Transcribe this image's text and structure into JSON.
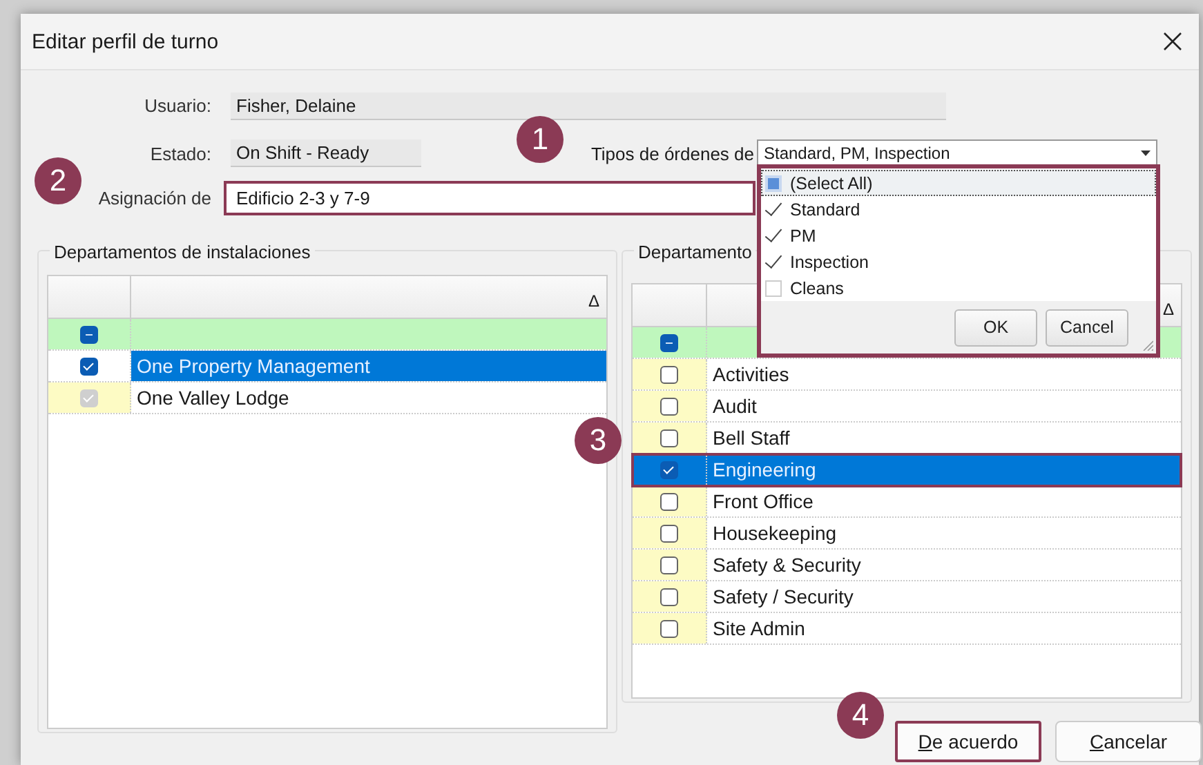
{
  "window": {
    "title": "Editar perfil de turno"
  },
  "form": {
    "user": {
      "label": "Usuario:",
      "value": "Fisher, Delaine"
    },
    "status": {
      "label": "Estado:",
      "value": "On Shift - Ready"
    },
    "order_types": {
      "label": "Tipos de órdenes de",
      "value": "Standard, PM, Inspection",
      "expanded": true
    },
    "assignment": {
      "label": "Asignación de",
      "value": "Edificio 2-3 y 7-9",
      "highlighted": true
    }
  },
  "order_types_popup": {
    "highlighted": true,
    "items": [
      {
        "label": "(Select All)",
        "indeterminate": true,
        "selected": true
      },
      {
        "label": "Standard",
        "checked": true,
        "indeterminate": false,
        "selected": false
      },
      {
        "label": "PM",
        "checked": true,
        "indeterminate": false,
        "selected": false
      },
      {
        "label": "Inspection",
        "checked": true,
        "indeterminate": false,
        "selected": false
      },
      {
        "label": "Cleans",
        "checked": false,
        "indeterminate": false,
        "selected": false
      }
    ],
    "buttons": [
      "OK",
      "Cancel"
    ]
  },
  "facility_departments": {
    "title": "Departamentos de instalaciones",
    "sort_mark": "Δ",
    "filter": {
      "indeterminate": true
    },
    "rows": [
      {
        "name": "One Property Management",
        "checked": true,
        "disabled": false,
        "selected": true,
        "highlighted": false
      },
      {
        "name": "One Valley Lodge",
        "checked": true,
        "disabled": true,
        "selected": false,
        "highlighted": false
      }
    ]
  },
  "departments": {
    "title": "Departamento",
    "sort_mark": "Δ",
    "filter": {
      "indeterminate": true
    },
    "rows": [
      {
        "name": "Activities",
        "checked": false,
        "disabled": false,
        "selected": false,
        "highlighted": false
      },
      {
        "name": "Audit",
        "checked": false,
        "disabled": false,
        "selected": false,
        "highlighted": false
      },
      {
        "name": "Bell Staff",
        "checked": false,
        "disabled": false,
        "selected": false,
        "highlighted": false
      },
      {
        "name": "Engineering",
        "checked": true,
        "disabled": false,
        "selected": true,
        "highlighted": true
      },
      {
        "name": "Front Office",
        "checked": false,
        "disabled": false,
        "selected": false,
        "highlighted": false
      },
      {
        "name": "Housekeeping",
        "checked": false,
        "disabled": false,
        "selected": false,
        "highlighted": false
      },
      {
        "name": "Safety & Security",
        "checked": false,
        "disabled": false,
        "selected": false,
        "highlighted": false
      },
      {
        "name": "Safety / Security",
        "checked": false,
        "disabled": false,
        "selected": false,
        "highlighted": false
      },
      {
        "name": "Site Admin",
        "checked": false,
        "disabled": false,
        "selected": false,
        "highlighted": false
      }
    ]
  },
  "buttons": [
    {
      "label": "De acuerdo",
      "highlighted": true
    },
    {
      "label": "Cancelar",
      "highlighted": false
    }
  ],
  "callouts": [
    {
      "number": "1"
    },
    {
      "number": "2"
    },
    {
      "number": "3"
    },
    {
      "number": "4"
    }
  ]
}
